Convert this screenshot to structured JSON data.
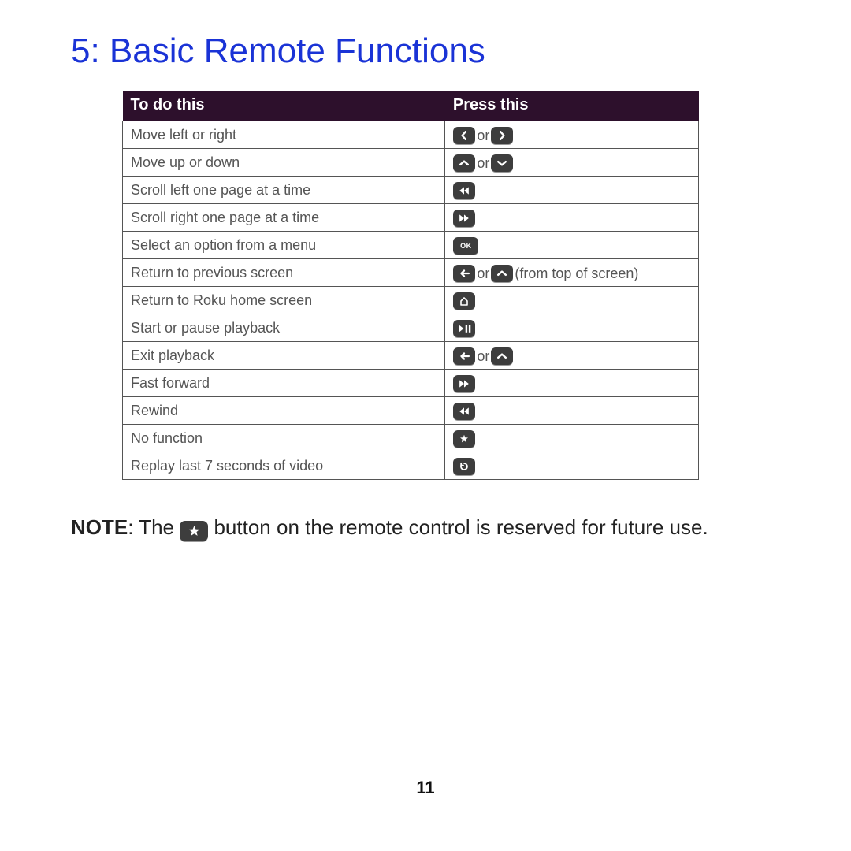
{
  "heading": "5: Basic Remote Functions",
  "table": {
    "head": {
      "c1": "To do this",
      "c2": "Press this"
    },
    "rows": [
      {
        "action": "Move left or right",
        "buttons": [
          "left"
        ],
        "sep": "or",
        "buttons2": [
          "right"
        ],
        "trail": ""
      },
      {
        "action": "Move up or down",
        "buttons": [
          "up"
        ],
        "sep": "or",
        "buttons2": [
          "down"
        ],
        "trail": ""
      },
      {
        "action": "Scroll left one page at a time",
        "buttons": [
          "rewind"
        ],
        "sep": "",
        "buttons2": [],
        "trail": ""
      },
      {
        "action": "Scroll right one page at a time",
        "buttons": [
          "forward"
        ],
        "sep": "",
        "buttons2": [],
        "trail": ""
      },
      {
        "action": "Select an option from a menu",
        "buttons": [
          "ok"
        ],
        "sep": "",
        "buttons2": [],
        "trail": ""
      },
      {
        "action": "Return to previous screen",
        "buttons": [
          "back"
        ],
        "sep": "or",
        "buttons2": [
          "up"
        ],
        "trail": " (from top of screen)"
      },
      {
        "action": "Return to Roku home screen",
        "buttons": [
          "home"
        ],
        "sep": "",
        "buttons2": [],
        "trail": ""
      },
      {
        "action": "Start or pause playback",
        "buttons": [
          "playpause"
        ],
        "sep": "",
        "buttons2": [],
        "trail": ""
      },
      {
        "action": "Exit playback",
        "buttons": [
          "back"
        ],
        "sep": "or",
        "buttons2": [
          "up"
        ],
        "trail": ""
      },
      {
        "action": "Fast forward",
        "buttons": [
          "forward"
        ],
        "sep": "",
        "buttons2": [],
        "trail": ""
      },
      {
        "action": "Rewind",
        "buttons": [
          "rewind"
        ],
        "sep": "",
        "buttons2": [],
        "trail": ""
      },
      {
        "action": "No function",
        "buttons": [
          "star"
        ],
        "sep": "",
        "buttons2": [],
        "trail": ""
      },
      {
        "action": "Replay last 7 seconds of video",
        "buttons": [
          "replay"
        ],
        "sep": "",
        "buttons2": [],
        "trail": ""
      }
    ]
  },
  "note": {
    "label": "NOTE",
    "before": ":  The  ",
    "icon": "star",
    "after": "  button on the remote control is reserved for future use."
  },
  "page_number": "11"
}
